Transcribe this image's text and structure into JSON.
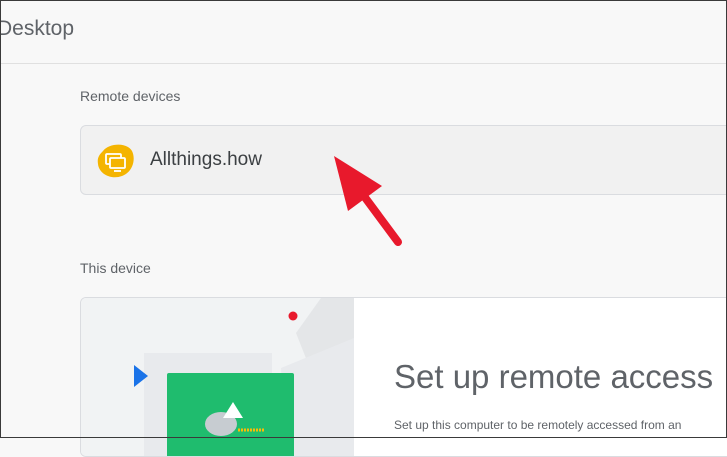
{
  "header": {
    "title": "Desktop"
  },
  "remote_devices": {
    "label": "Remote devices",
    "devices": [
      {
        "name": "Allthings.how",
        "icon": "computer-icon",
        "icon_color": "#f4b400"
      }
    ]
  },
  "this_device": {
    "label": "This device",
    "setup_title": "Set up remote access",
    "setup_description": "Set up this computer to be remotely accessed from an"
  },
  "annotation": {
    "icon": "red-arrow-annotation",
    "color": "#e8192c"
  }
}
